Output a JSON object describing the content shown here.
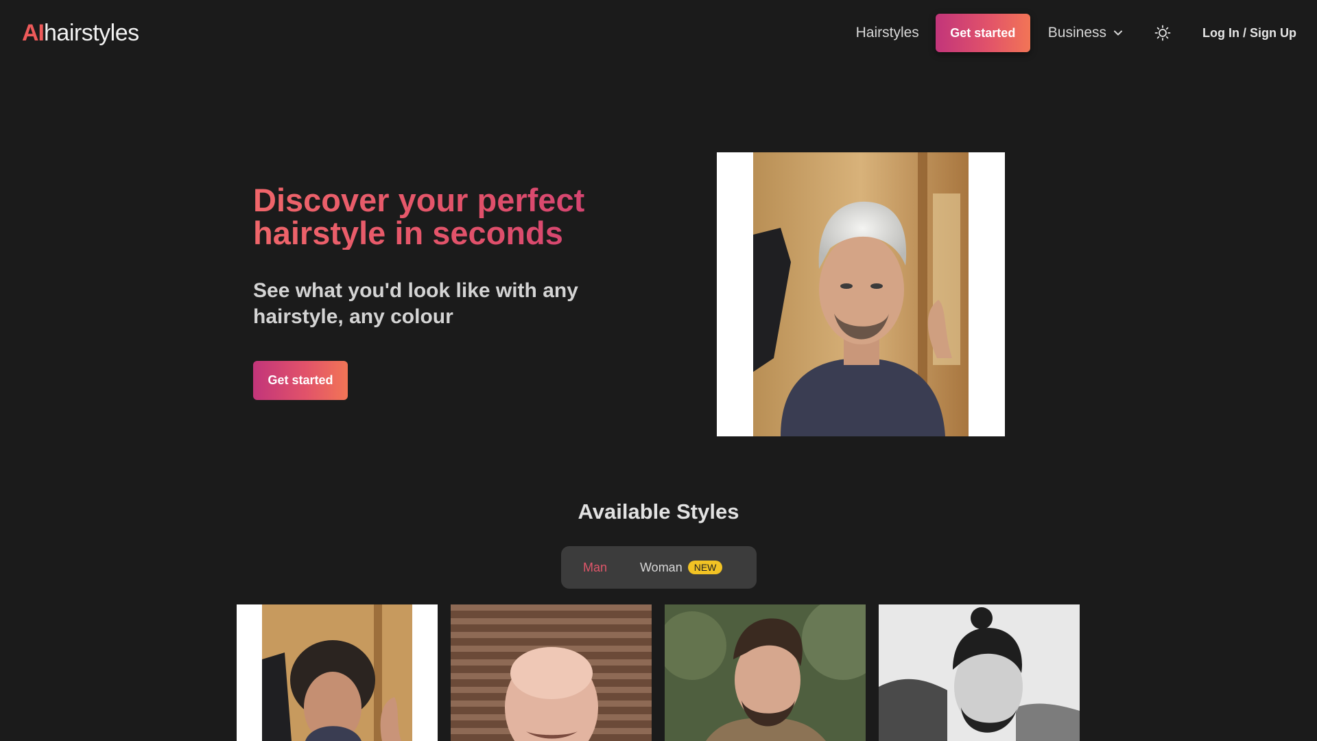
{
  "header": {
    "logo_ai": "AI",
    "logo_rest": "hairstyles",
    "nav_hairstyles": "Hairstyles",
    "nav_cta": "Get started",
    "nav_business": "Business",
    "login": "Log In / Sign Up"
  },
  "hero": {
    "title": "Discover your perfect hairstyle in seconds",
    "subtitle": "See what you'd look like with any hairstyle, any colour",
    "cta": "Get started"
  },
  "styles": {
    "title": "Available Styles",
    "tabs": [
      {
        "label": "Man",
        "active": true
      },
      {
        "label": "Woman",
        "active": false,
        "badge": "NEW"
      }
    ]
  },
  "colors": {
    "background": "#1b1b1b",
    "accent_start": "#c2357a",
    "accent_end": "#f27556",
    "badge": "#f2c324"
  },
  "icons": [
    "chevron-down-icon",
    "sun-icon"
  ]
}
